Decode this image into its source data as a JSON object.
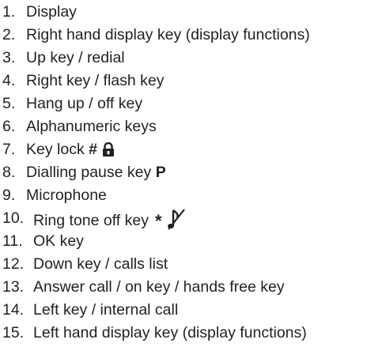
{
  "legend": {
    "items": [
      {
        "number": "1.",
        "text": "Display"
      },
      {
        "number": "2.",
        "text": "Right hand display key (display functions)"
      },
      {
        "number": "3.",
        "text": "Up key / redial"
      },
      {
        "number": "4.",
        "text": "Right key / flash key"
      },
      {
        "number": "5.",
        "text": "Hang up / off key"
      },
      {
        "number": "6.",
        "text": "Alphanumeric keys"
      },
      {
        "number": "7.",
        "text": "Key lock",
        "symbol": "#",
        "icon": "padlock-icon"
      },
      {
        "number": "8.",
        "text": "Dialling pause key",
        "symbol": "P"
      },
      {
        "number": "9.",
        "text": "Microphone"
      },
      {
        "number": "10.",
        "text": "Ring tone off key",
        "symbol": "*",
        "icon": "music-note-crossed-icon"
      },
      {
        "number": "11.",
        "text": "OK key"
      },
      {
        "number": "12.",
        "text": "Down key / calls list"
      },
      {
        "number": "13.",
        "text": "Answer call / on key / hands free key"
      },
      {
        "number": "14.",
        "text": "Left key / internal call"
      },
      {
        "number": "15.",
        "text": "Left hand display key (display functions)"
      }
    ]
  }
}
